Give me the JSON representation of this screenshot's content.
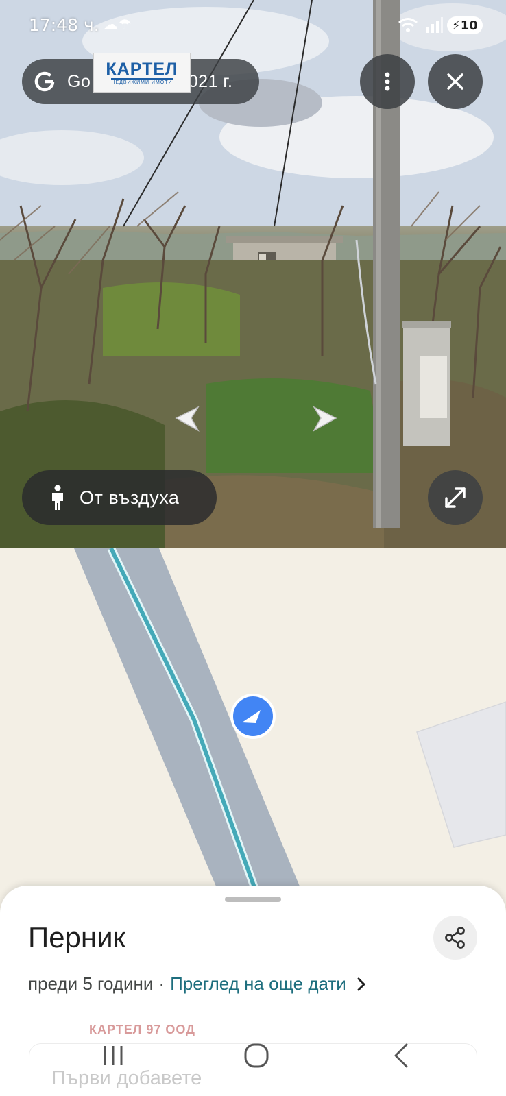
{
  "status_bar": {
    "time": "17:48 ч.",
    "weather": "☁☂",
    "battery": "10"
  },
  "street_view": {
    "provider": "Go",
    "capture_date": "2021 г.",
    "watermark": {
      "word": "КАРТЕЛ",
      "subtitle": "НЕДВИЖИМИ ИМОТИ"
    },
    "aerial_button": "От въздуха"
  },
  "icons": {
    "menu": "more-vert-icon",
    "close": "close-icon",
    "expand": "expand-icon",
    "left": "arrow-left-icon",
    "right": "arrow-right-icon",
    "pegman": "pegman-icon",
    "share": "share-icon"
  },
  "colors": {
    "route": "#44a9b8",
    "road": "#a9b3bf",
    "marker": "#4285f4",
    "link": "#1e6e7e",
    "map_bg": "#f3efe5"
  },
  "sheet": {
    "title": "Перник",
    "age": "преди 5 години",
    "separator": "·",
    "more_dates": "Преглед на още дати",
    "company": "КАРТЕЛ 97 ООД",
    "add_photos": "Първи добавете"
  }
}
